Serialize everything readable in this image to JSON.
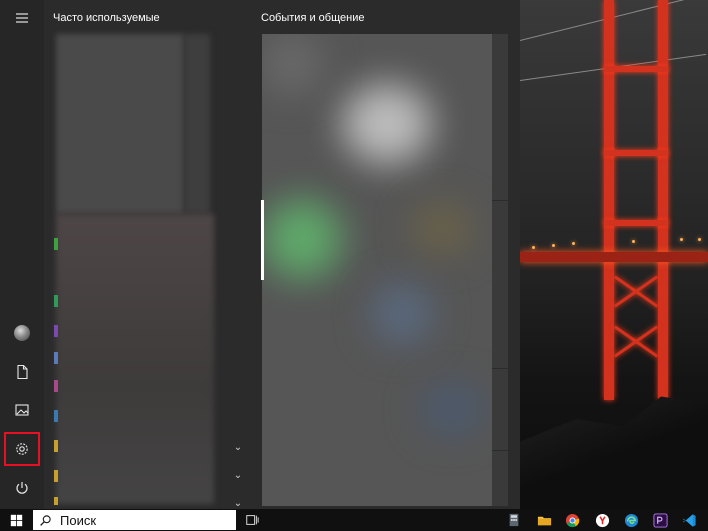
{
  "start_menu": {
    "frequent_title": "Часто используемые",
    "tiles_group_title": "События и общение",
    "rail": [
      {
        "name": "hamburger-menu-icon"
      },
      {
        "name": "user-avatar"
      },
      {
        "name": "documents-icon"
      },
      {
        "name": "pictures-icon"
      },
      {
        "name": "settings-icon",
        "highlighted": true
      },
      {
        "name": "power-icon"
      }
    ]
  },
  "taskbar": {
    "search_placeholder": "Поиск",
    "pinned": [
      "task-view-icon",
      "calculator-icon",
      "file-explorer-icon",
      "chrome-icon",
      "yandex-browser-icon",
      "edge-icon",
      "premiere-icon",
      "vscode-icon"
    ]
  },
  "colors": {
    "highlight": "#e81123",
    "start_bg": "#2b2b2b",
    "taskbar_bg": "#101010"
  }
}
